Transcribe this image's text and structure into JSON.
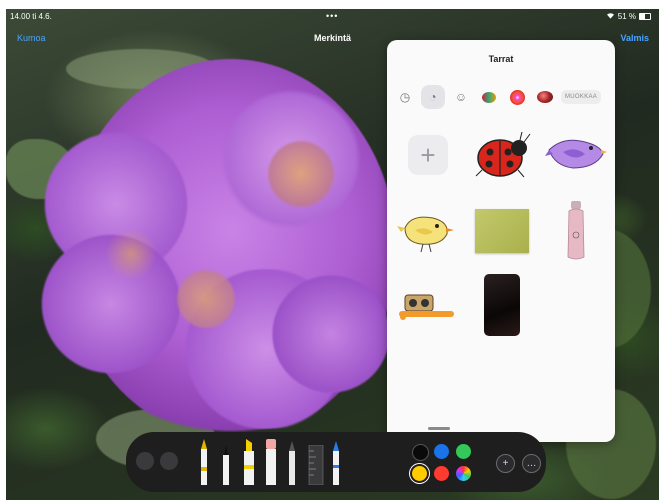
{
  "status": {
    "time": "14.00",
    "date": "ti 4.6.",
    "battery": "51 %"
  },
  "nav": {
    "cancel": "Kumoa",
    "title": "Merkintä",
    "done": "Valmis"
  },
  "panel": {
    "title": "Tarrat",
    "categories": [
      {
        "name": "recent-icon",
        "glyph": "◷"
      },
      {
        "name": "stickers-icon",
        "glyph": "◔"
      },
      {
        "name": "emoji-icon",
        "glyph": "☺"
      }
    ],
    "edit_label": "MUOKKAA"
  },
  "toolbar": {
    "actions": [
      {
        "name": "add-icon",
        "glyph": "+"
      },
      {
        "name": "more-icon",
        "glyph": "…"
      }
    ]
  },
  "colors": {
    "black": "#0a0a0a",
    "blue": "#1a73e8",
    "green": "#34c759",
    "yellow": "#ffcc00",
    "red": "#ff3b30"
  }
}
